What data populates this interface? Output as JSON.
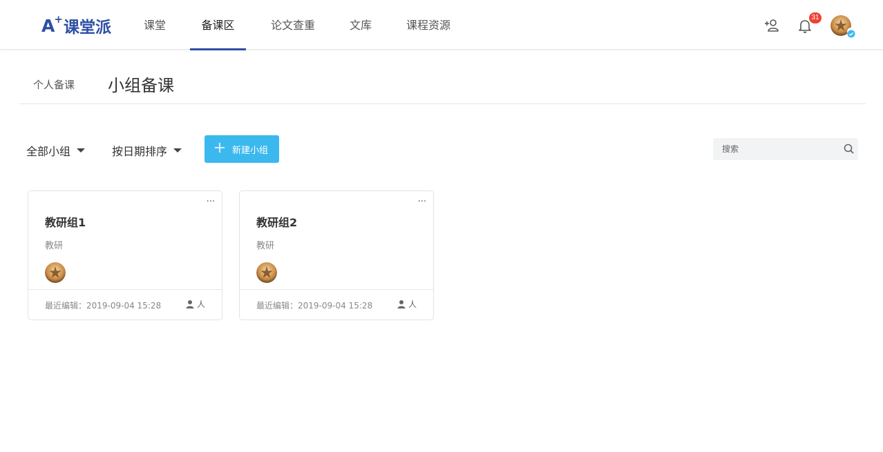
{
  "header": {
    "logo_a": "A",
    "logo_plus": "+",
    "logo_text": "课堂派",
    "tabs": [
      {
        "label": "课堂"
      },
      {
        "label": "备课区"
      },
      {
        "label": "论文查重"
      },
      {
        "label": "文库"
      },
      {
        "label": "课程资源"
      }
    ],
    "active_tab": "备课区",
    "notification_count": "31",
    "brand_color": "#2d4fa5"
  },
  "subnav": {
    "personal_label": "个人备课",
    "group_label": "小组备课",
    "active": "小组备课"
  },
  "toolbar": {
    "filter_label": "全部小组",
    "sort_label": "按日期排序",
    "new_button_label": "新建小组",
    "search_placeholder": "搜索",
    "accent_color": "#3bb9ef"
  },
  "groups": [
    {
      "name": "教研组1",
      "description": "教研",
      "more": "···",
      "last_edited": "最近编辑：2019-09-04 15:28",
      "people_label": "人"
    },
    {
      "name": "教研组2",
      "description": "教研",
      "more": "···",
      "last_edited": "最近编辑：2019-09-04 15:28",
      "people_label": "人"
    }
  ]
}
